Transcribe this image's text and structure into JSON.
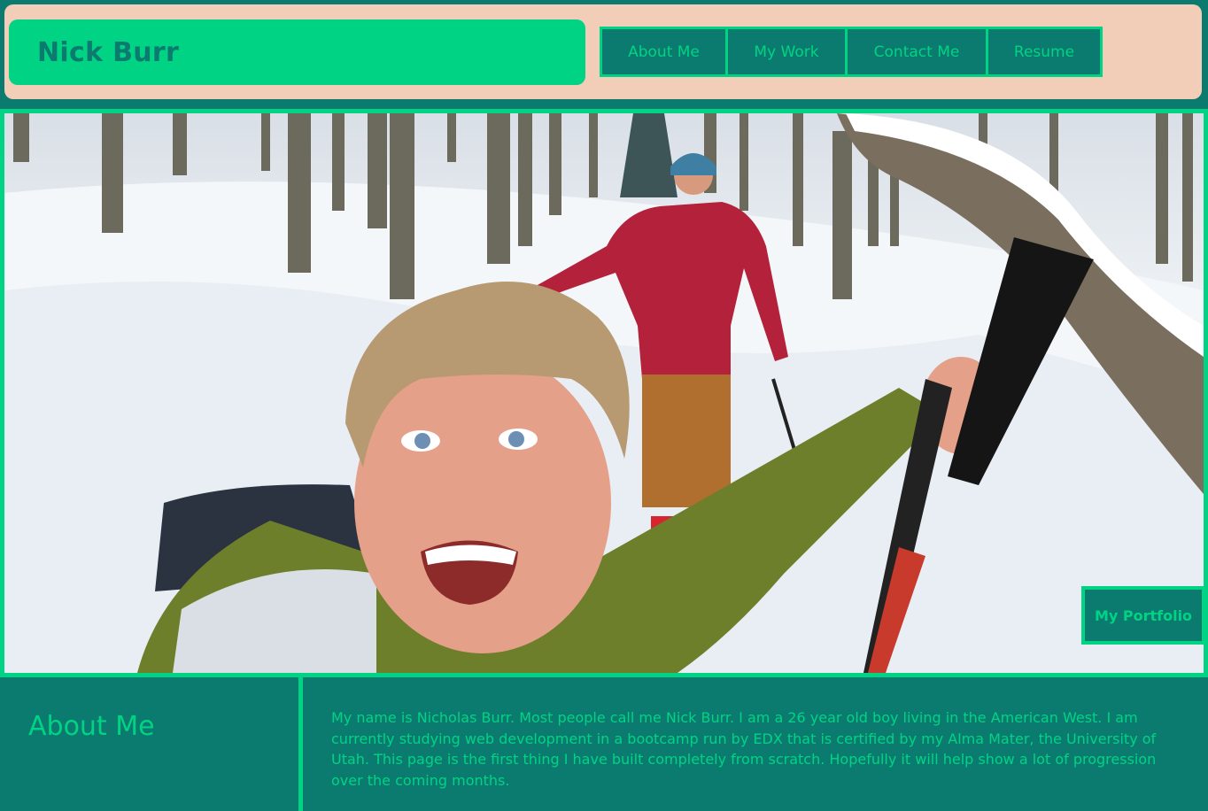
{
  "header": {
    "brand_name": "Nick Burr",
    "nav": [
      {
        "label": "About Me"
      },
      {
        "label": "My Work"
      },
      {
        "label": "Contact Me"
      },
      {
        "label": "Resume"
      }
    ]
  },
  "hero": {
    "portfolio_button": "My Portfolio"
  },
  "about": {
    "heading": "About Me",
    "body": "My name is Nicholas Burr. Most people call me Nick Burr. I am a 26 year old boy living in the American West. I am currently studying web development in a bootcamp run by EDX that is certified by my Alma Mater, the University of Utah. This page is the first thing I have built completely from scratch. Hopefully it will help show a lot of progression over the coming months."
  },
  "colors": {
    "teal": "#0c7b6f",
    "green": "#00d384",
    "peach": "#f2cdb7"
  }
}
